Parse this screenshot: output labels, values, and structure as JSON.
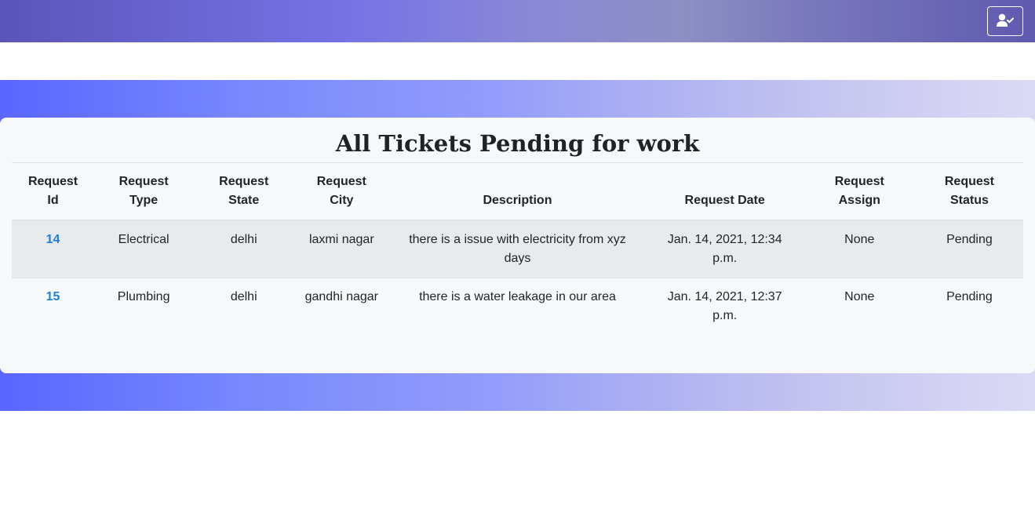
{
  "topbar": {
    "user_icon": "user-check-icon"
  },
  "card": {
    "title": "All Tickets Pending for work"
  },
  "table": {
    "headers": [
      "Request Id",
      "Request Type",
      "Request State",
      "Request City",
      "Description",
      "Request Date",
      "Request Assign",
      "Request Status"
    ],
    "rows": [
      {
        "id": "14",
        "type": "Electrical",
        "state": "delhi",
        "city": "laxmi nagar",
        "description": "there is a issue with electricity from xyz days",
        "date": "Jan. 14, 2021, 12:34 p.m.",
        "assign": "None",
        "status": "Pending"
      },
      {
        "id": "15",
        "type": "Plumbing",
        "state": "delhi",
        "city": "gandhi nagar",
        "description": "there is a water leakage in our area",
        "date": "Jan. 14, 2021, 12:37 p.m.",
        "assign": "None",
        "status": "Pending"
      }
    ]
  },
  "colors": {
    "link": "#1e7fd8",
    "band_start": "#5a66ff",
    "band_end": "#dbdaf5",
    "topbar_accent": "#7572e6"
  }
}
